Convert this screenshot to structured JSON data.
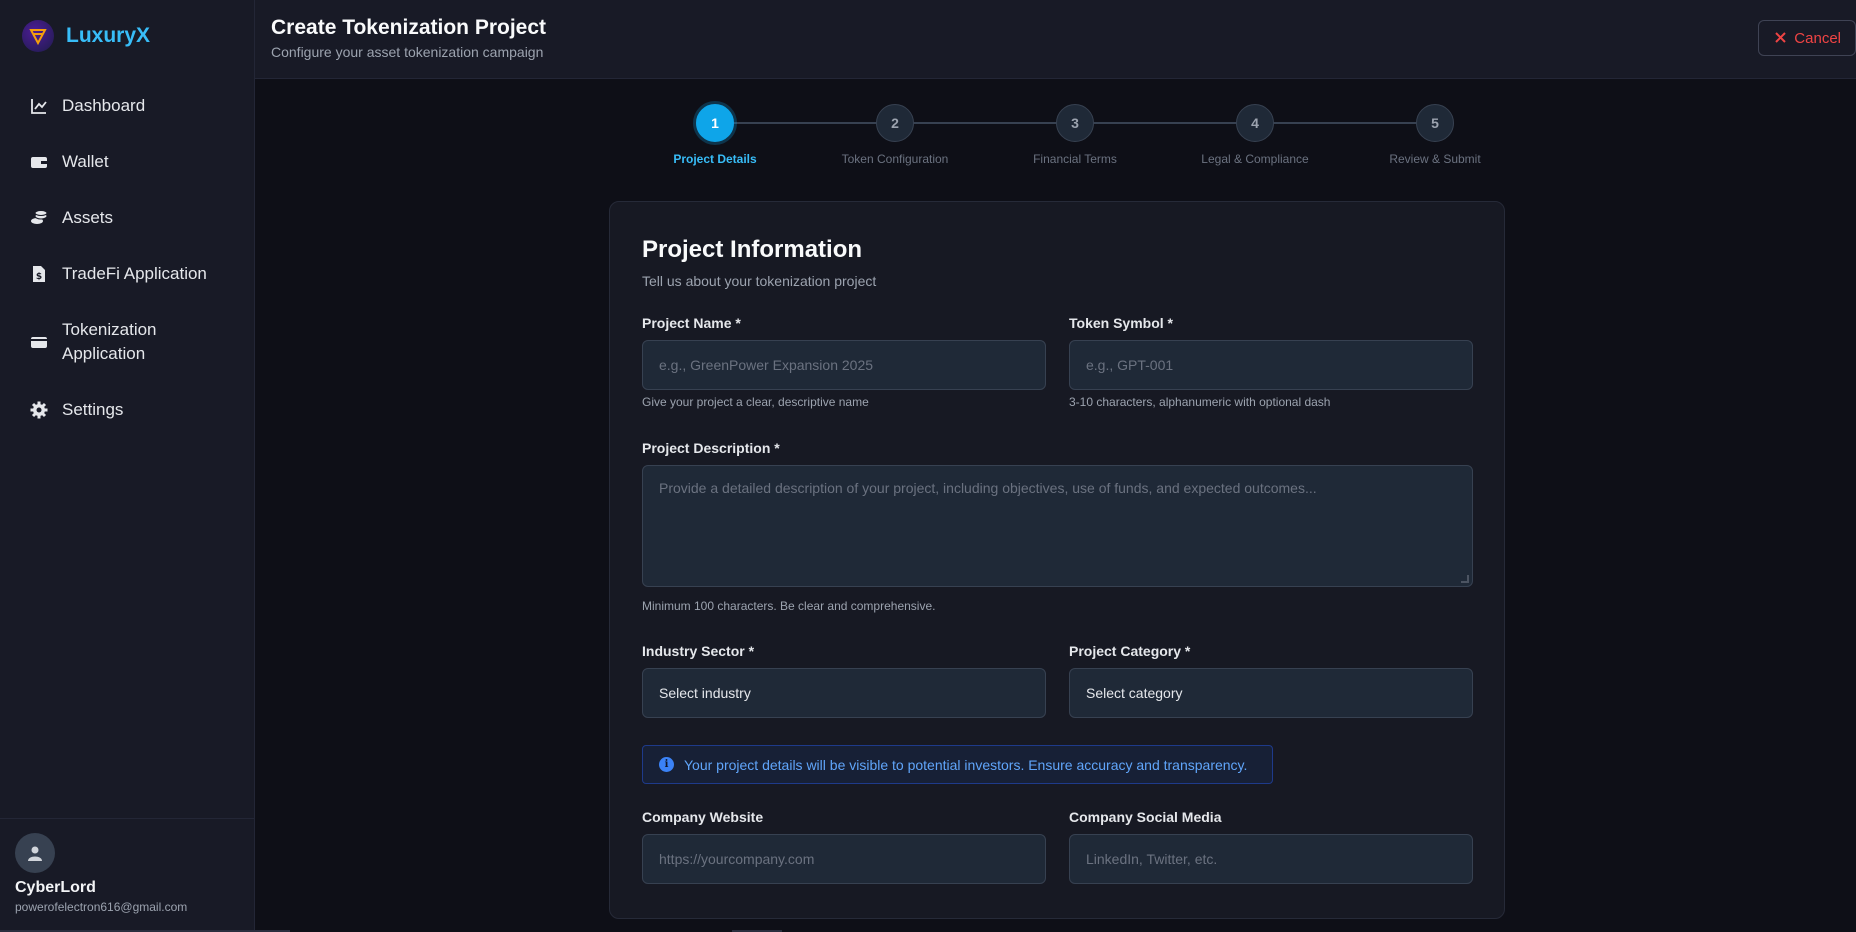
{
  "brand": {
    "name": "LuxuryX",
    "color": "#38bdf8"
  },
  "sidebar": {
    "items": [
      {
        "label": "Dashboard",
        "icon": "chart-line-icon"
      },
      {
        "label": "Wallet",
        "icon": "wallet-icon"
      },
      {
        "label": "Assets",
        "icon": "coins-icon"
      },
      {
        "label": "TradeFi Application",
        "icon": "file-dollar-icon"
      },
      {
        "label": "Tokenization Application",
        "icon": "card-icon"
      },
      {
        "label": "Settings",
        "icon": "gear-icon"
      }
    ]
  },
  "user": {
    "name": "CyberLord",
    "email": "powerofelectron616@gmail.com"
  },
  "header": {
    "title": "Create Tokenization Project",
    "subtitle": "Configure your asset tokenization campaign",
    "cancel_label": "Cancel"
  },
  "stepper": {
    "steps": [
      {
        "number": "1",
        "label": "Project Details",
        "active": true
      },
      {
        "number": "2",
        "label": "Token Configuration",
        "active": false
      },
      {
        "number": "3",
        "label": "Financial Terms",
        "active": false
      },
      {
        "number": "4",
        "label": "Legal & Compliance",
        "active": false
      },
      {
        "number": "5",
        "label": "Review & Submit",
        "active": false
      }
    ]
  },
  "form": {
    "title": "Project Information",
    "subtitle": "Tell us about your tokenization project",
    "project_name": {
      "label": "Project Name *",
      "placeholder": "e.g., GreenPower Expansion 2025",
      "hint": "Give your project a clear, descriptive name"
    },
    "token_symbol": {
      "label": "Token Symbol *",
      "placeholder": "e.g., GPT-001",
      "hint": "3-10 characters, alphanumeric with optional dash"
    },
    "description": {
      "label": "Project Description *",
      "placeholder": "Provide a detailed description of your project, including objectives, use of funds, and expected outcomes...",
      "hint": "Minimum 100 characters. Be clear and comprehensive."
    },
    "industry": {
      "label": "Industry Sector *",
      "value": "Select industry"
    },
    "category": {
      "label": "Project Category *",
      "value": "Select category"
    },
    "info_message": "Your project details will be visible to potential investors. Ensure accuracy and transparency.",
    "website": {
      "label": "Company Website",
      "placeholder": "https://yourcompany.com"
    },
    "social": {
      "label": "Company Social Media",
      "placeholder": "LinkedIn, Twitter, etc."
    }
  }
}
